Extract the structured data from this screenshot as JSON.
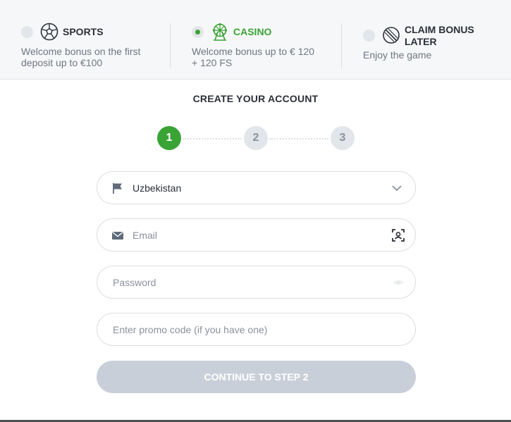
{
  "bonuses": [
    {
      "icon": "soccer-ball-icon",
      "title": "SPORTS",
      "desc_line1": "Welcome bonus on the first",
      "desc_line2": "deposit up to €100",
      "selected": false
    },
    {
      "icon": "ferris-wheel-icon",
      "title": "CASINO",
      "desc_line1": "Welcome bonus up to € 120",
      "desc_line2": "+ 120 FS",
      "selected": true
    },
    {
      "icon": "no-bonus-icon",
      "title_line1": "CLAIM BONUS",
      "title_line2": "LATER",
      "desc_line1": "Enjoy the game",
      "selected": false
    }
  ],
  "form": {
    "title": "CREATE YOUR ACCOUNT",
    "steps": [
      "1",
      "2",
      "3"
    ],
    "active_step": 1,
    "country": {
      "icon": "flag-icon",
      "value": "Uzbekistan",
      "chevron_icon": "chevron-down-icon"
    },
    "email": {
      "icon": "envelope-icon",
      "placeholder": "Email",
      "trailing_icon": "face-scan-icon"
    },
    "password": {
      "placeholder": "Password",
      "trailing_icon": "eye-icon"
    },
    "promo": {
      "placeholder": "Enter promo code (if you have one)"
    },
    "submit_label": "CONTINUE TO STEP 2"
  },
  "colors": {
    "accent": "#3aa335",
    "disabled_button": "#c9cfd9",
    "muted_text": "#6f7683"
  }
}
